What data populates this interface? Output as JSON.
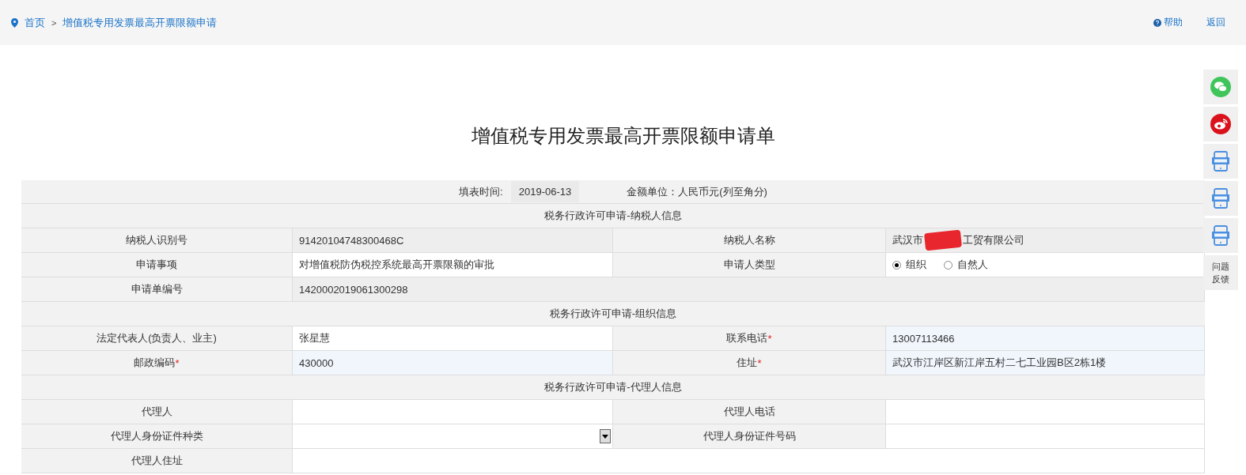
{
  "breadcrumb": {
    "home": "首页",
    "separator": ">",
    "current": "增值税专用发票最高开票限额申请"
  },
  "header_links": {
    "help": "帮助",
    "back": "返回"
  },
  "title": "增值税专用发票最高开票限额申请单",
  "info": {
    "fill_time_label": "填表时间:",
    "fill_time": "2019-06-13",
    "amount_unit": "金额单位：人民币元(列至角分)"
  },
  "sections": [
    {
      "title": "税务行政许可申请-纳税人信息",
      "rows": [
        {
          "cells": [
            {
              "kind": "label",
              "text": "纳税人识别号"
            },
            {
              "kind": "text",
              "text": "91420104748300468C",
              "readonly": true
            },
            {
              "kind": "label",
              "text": "纳税人名称"
            },
            {
              "kind": "redacted",
              "before": "武汉市",
              "after": "工贸有限公司",
              "readonly": true
            }
          ]
        },
        {
          "cells": [
            {
              "kind": "label",
              "text": "申请事项"
            },
            {
              "kind": "text",
              "text": "对增值税防伪税控系统最高开票限额的审批",
              "readonly": false,
              "highlighted": false
            },
            {
              "kind": "label",
              "text": "申请人类型"
            },
            {
              "kind": "radio",
              "options": [
                {
                  "label": "组织",
                  "selected": true
                },
                {
                  "label": "自然人",
                  "selected": false
                }
              ]
            }
          ]
        },
        {
          "cells": [
            {
              "kind": "label",
              "text": "申请单编号"
            },
            {
              "kind": "text",
              "text": "1420002019061300298",
              "readonly": true,
              "wide": true
            }
          ]
        }
      ]
    },
    {
      "title": "税务行政许可申请-组织信息",
      "rows": [
        {
          "cells": [
            {
              "kind": "label",
              "text": "法定代表人(负责人、业主)"
            },
            {
              "kind": "text",
              "text": "张星慧",
              "readonly": false,
              "highlighted": false
            },
            {
              "kind": "label",
              "text": "联系电话",
              "required_mark": "*"
            },
            {
              "kind": "text",
              "text": "13007113466",
              "readonly": false,
              "highlighted": true
            }
          ]
        },
        {
          "cells": [
            {
              "kind": "label",
              "text": "邮政编码",
              "required_mark": "*"
            },
            {
              "kind": "text",
              "text": "430000",
              "readonly": false,
              "highlighted": true
            },
            {
              "kind": "label",
              "text": "住址",
              "required_mark": "*"
            },
            {
              "kind": "text",
              "text": "武汉市江岸区新江岸五村二七工业园B区2栋1楼",
              "readonly": false,
              "highlighted": true
            }
          ]
        }
      ]
    },
    {
      "title": "税务行政许可申请-代理人信息",
      "rows": [
        {
          "cells": [
            {
              "kind": "label",
              "text": "代理人"
            },
            {
              "kind": "text",
              "readonly": false,
              "highlighted": false
            },
            {
              "kind": "label",
              "text": "代理人电话"
            },
            {
              "kind": "text",
              "readonly": false,
              "highlighted": false
            }
          ]
        },
        {
          "cells": [
            {
              "kind": "label",
              "text": "代理人身份证件种类"
            },
            {
              "kind": "select"
            },
            {
              "kind": "label",
              "text": "代理人身份证件号码"
            },
            {
              "kind": "text",
              "readonly": false,
              "highlighted": false
            }
          ]
        },
        {
          "cells": [
            {
              "kind": "label",
              "text": "代理人住址"
            },
            {
              "kind": "text",
              "readonly": false,
              "highlighted": false,
              "wide": true
            }
          ]
        }
      ]
    }
  ],
  "side_tools": [
    {
      "kind": "wechat"
    },
    {
      "kind": "weibo"
    },
    {
      "kind": "app"
    },
    {
      "kind": "app"
    },
    {
      "kind": "app"
    },
    {
      "kind": "feedback",
      "text": "问题反馈"
    }
  ]
}
